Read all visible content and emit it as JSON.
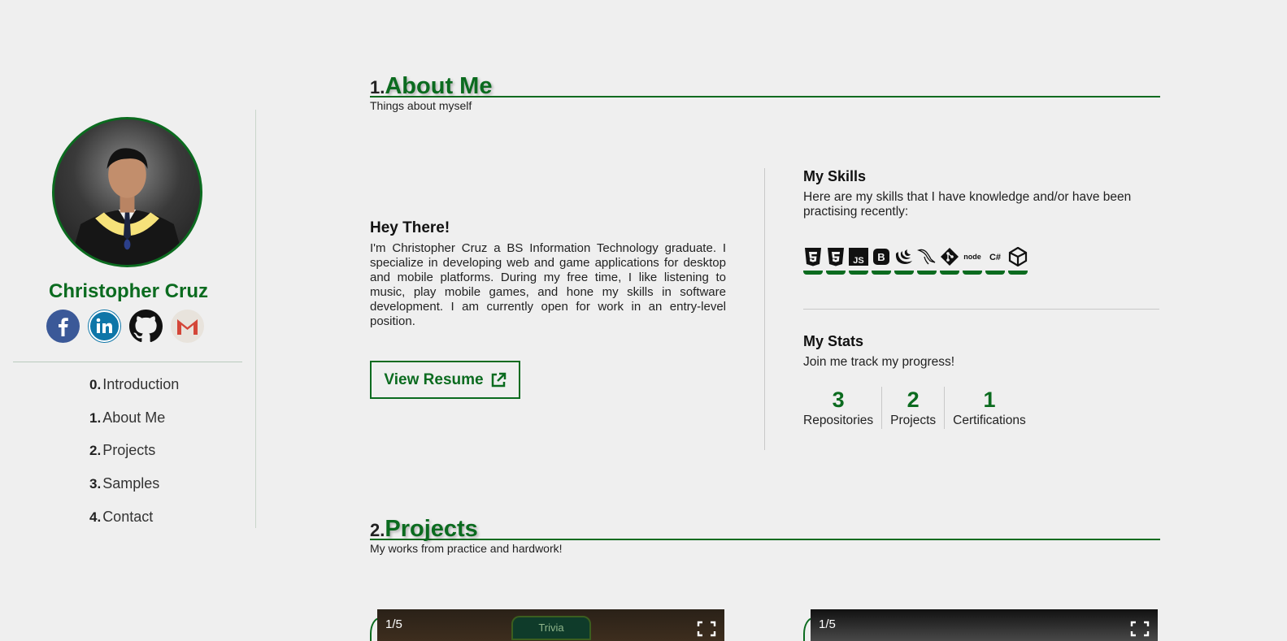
{
  "profile": {
    "name": "Christopher Cruz",
    "socials": [
      {
        "icon": "facebook-icon",
        "color": "#3b5998"
      },
      {
        "icon": "linkedin-icon",
        "color": "#0e76a8"
      },
      {
        "icon": "github-icon",
        "color": "#111111"
      },
      {
        "icon": "gmail-icon",
        "color": "#d44638"
      }
    ]
  },
  "nav": {
    "items": [
      {
        "num": "0.",
        "label": "Introduction"
      },
      {
        "num": "1.",
        "label": "About Me"
      },
      {
        "num": "2.",
        "label": "Projects"
      },
      {
        "num": "3.",
        "label": "Samples"
      },
      {
        "num": "4.",
        "label": "Contact"
      }
    ]
  },
  "about": {
    "num": "1.",
    "title": "About Me",
    "subtitle": "Things about myself",
    "hey_title": "Hey There!",
    "hey_text": "I'm Christopher Cruz a BS Information Technology graduate. I specialize in developing web and game applications for desktop and mobile platforms. During my free time, I like listening to music, play mobile games, and hone my skills in software development. I am currently open for work in an entry-level position.",
    "resume_label": "View Resume"
  },
  "skills": {
    "title": "My Skills",
    "desc": "Here are my skills that I have knowledge and/or have been practising recently:",
    "icons": [
      "html5-icon",
      "css3-icon",
      "javascript-icon",
      "bootstrap-icon",
      "jquery-icon",
      "mysql-icon",
      "git-icon",
      "nodejs-icon",
      "csharp-icon",
      "unity-icon"
    ],
    "labels": {
      "js": "JS",
      "bootstrap": "B",
      "node": "node",
      "csharp": "C#"
    }
  },
  "stats": {
    "title": "My Stats",
    "desc": "Join me track my progress!",
    "items": [
      {
        "value": "3",
        "label": "Repositories"
      },
      {
        "value": "2",
        "label": "Projects"
      },
      {
        "value": "1",
        "label": "Certifications"
      }
    ]
  },
  "projects": {
    "num": "2.",
    "title": "Projects",
    "subtitle": "My works from practice and hardwork!",
    "cards": [
      {
        "counter": "1/5",
        "banner": "Trivia"
      },
      {
        "counter": "1/5"
      }
    ]
  },
  "colors": {
    "accent": "#0b6b1f",
    "background": "#efefef"
  }
}
